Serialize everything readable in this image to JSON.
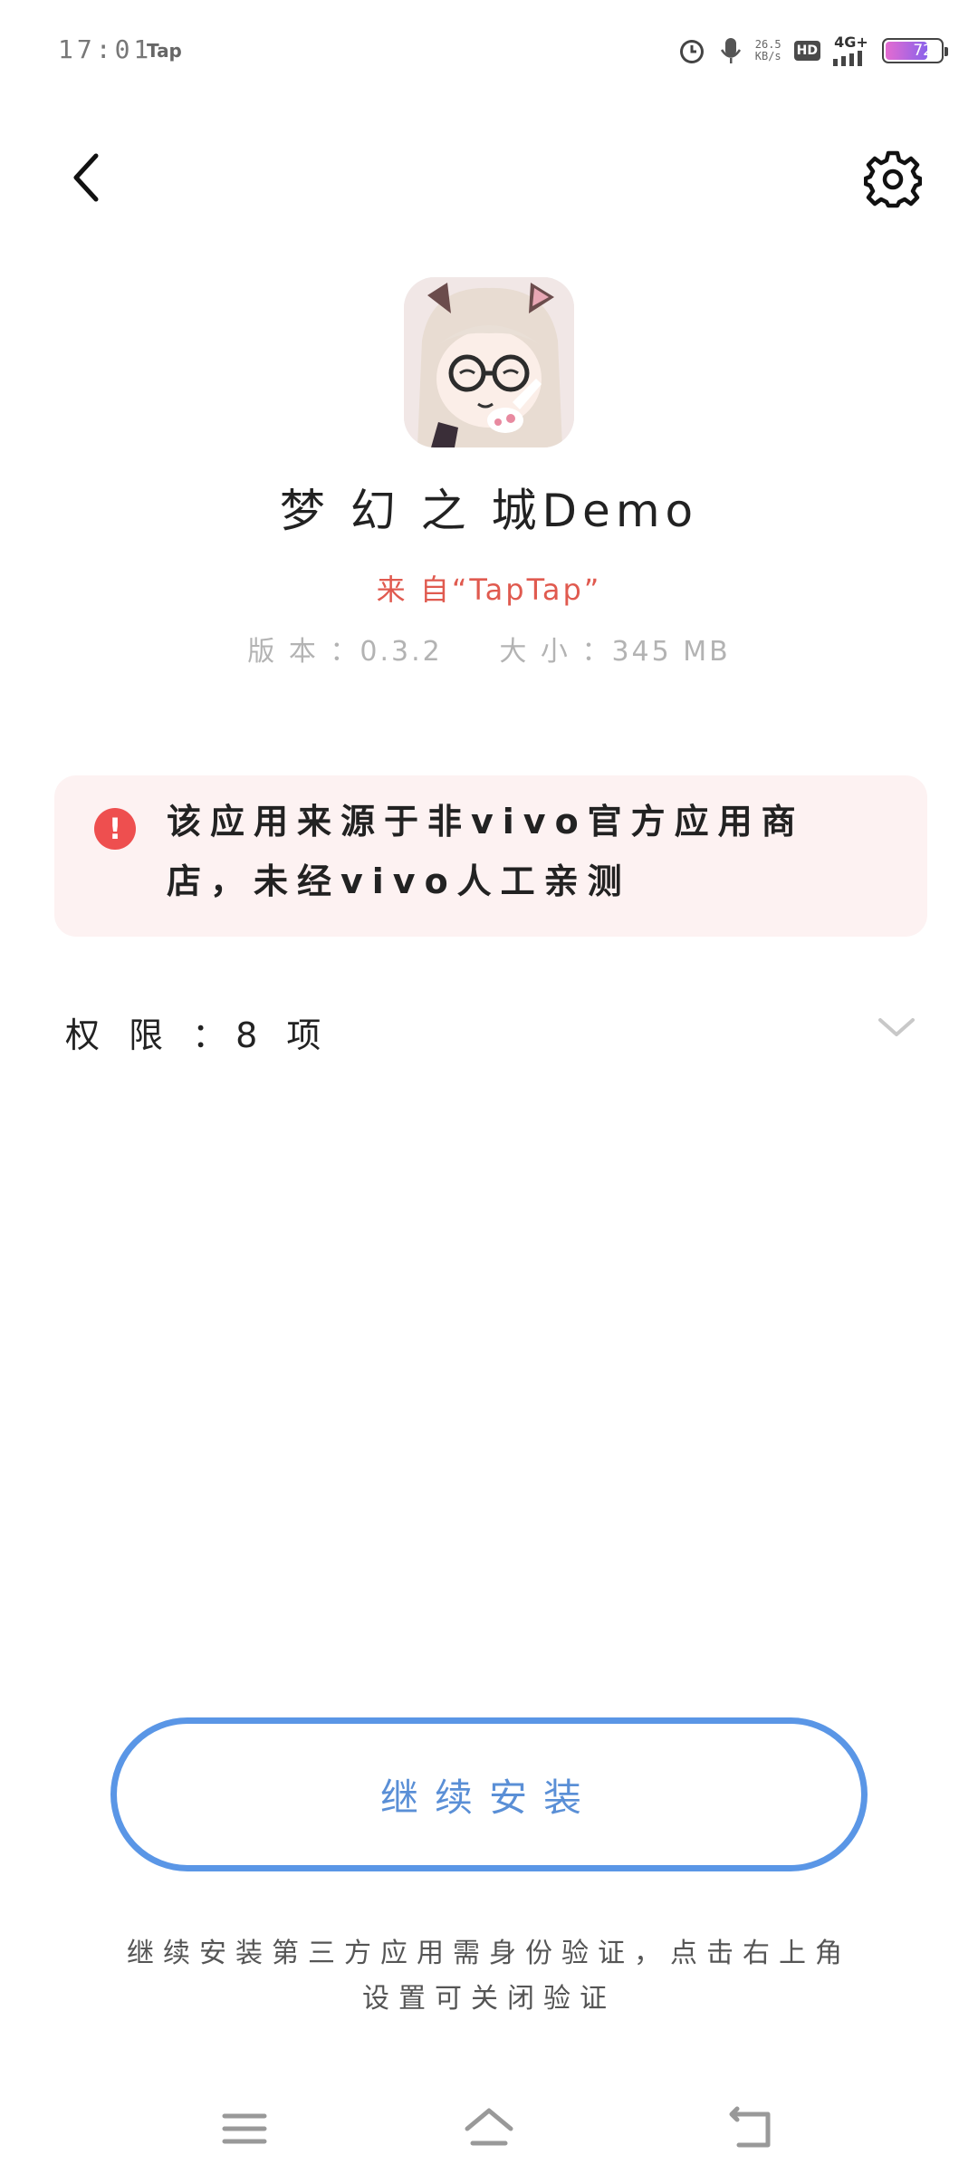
{
  "status_bar": {
    "time": "17:01",
    "app_label": "Tap",
    "net_speed_value": "26.5",
    "net_speed_unit": "KB/s",
    "hd_label": "HD",
    "network_label": "4G+",
    "battery_level": "72",
    "icons": [
      "alarm-icon",
      "mic-icon",
      "signal-icon",
      "battery-icon"
    ]
  },
  "nav": {
    "back_icon": "chevron-left-icon",
    "settings_icon": "gear-icon"
  },
  "app": {
    "name": "梦 幻 之 城Demo",
    "source": "来 自“TapTap”",
    "meta": "版 本 ：0.3.2     大 小 ：345 MB"
  },
  "warning": {
    "icon": "exclamation-icon",
    "text": "该应用来源于非vivo官方应用商店，未经vivo人工亲测"
  },
  "permissions": {
    "label": "权 限 ：8 项",
    "icon": "chevron-down-icon"
  },
  "continue_button": {
    "label": "继续安装"
  },
  "note": {
    "text": "继续安装第三方应用需身份验证，点击右上角设置可关闭验证"
  },
  "navbar": {
    "icons": [
      "menu-icon",
      "home-icon",
      "back-nav-icon"
    ]
  },
  "colors": {
    "accent": "#5a96e6",
    "warning": "#ee4f4f",
    "source_text": "#e05a4f",
    "warning_bg": "#fdf2f2"
  }
}
